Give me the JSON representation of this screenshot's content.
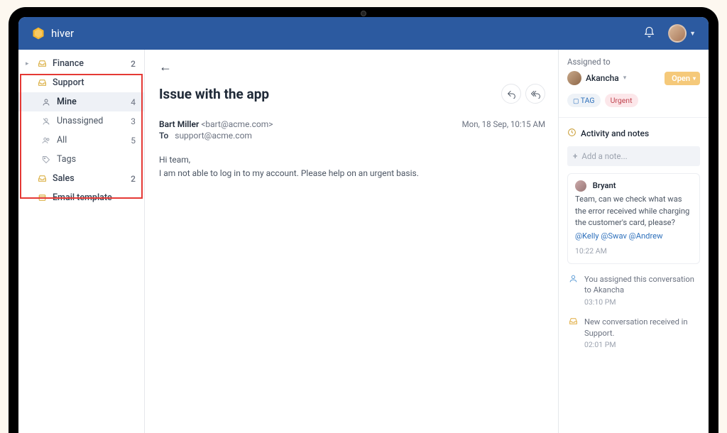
{
  "brand": {
    "name": "hiver"
  },
  "sidebar": {
    "items": [
      {
        "label": "Finance",
        "count": "2"
      },
      {
        "label": "Support"
      },
      {
        "label": "Sales",
        "count": "2"
      },
      {
        "label": "Email template"
      }
    ],
    "support_children": [
      {
        "label": "Mine",
        "count": "4"
      },
      {
        "label": "Unassigned",
        "count": "3"
      },
      {
        "label": "All",
        "count": "5"
      },
      {
        "label": "Tags"
      }
    ]
  },
  "email": {
    "subject": "Issue with the app",
    "from_name": "Bart Miller",
    "from_addr": "<bart@acme.com>",
    "to_label": "To",
    "to_addr": "support@acme.com",
    "date": "Mon, 18 Sep, 10:15 AM",
    "greeting": "Hi team,",
    "body_line": "I am not able to log in to my account. Please help on an urgent basis."
  },
  "panel": {
    "assigned_label": "Assigned to",
    "assignee": "Akancha",
    "status": "Open",
    "tag_label": "TAG",
    "tag_urgent": "Urgent",
    "activity_header": "Activity and notes",
    "add_note_placeholder": "Add a note...",
    "note": {
      "author": "Bryant",
      "msg": "Team, can we check what was the error received while charging the customer's card, please?",
      "mentions": "@Kelly @Swav @Andrew",
      "time": "10:22 AM"
    },
    "activity1": {
      "text": "You assigned this conversation to Akancha",
      "time": "03:10 PM"
    },
    "activity2": {
      "text": "New conversation received in Support.",
      "time": "02:01 PM"
    }
  }
}
